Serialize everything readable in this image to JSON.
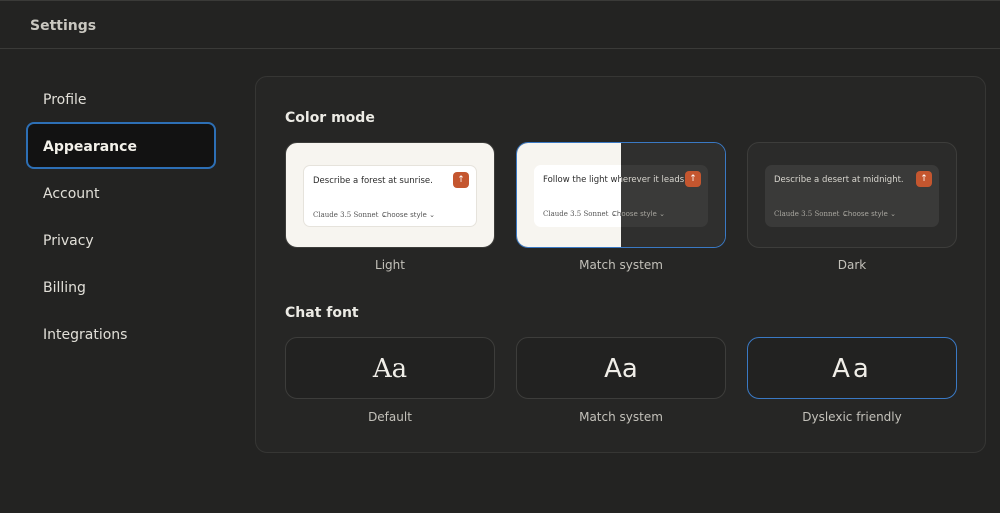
{
  "header": {
    "title": "Settings"
  },
  "sidebar": {
    "items": [
      {
        "label": "Profile"
      },
      {
        "label": "Appearance"
      },
      {
        "label": "Account"
      },
      {
        "label": "Privacy"
      },
      {
        "label": "Billing"
      },
      {
        "label": "Integrations"
      }
    ]
  },
  "color_mode": {
    "title": "Color mode",
    "selected": "Match system",
    "options": [
      {
        "label": "Light",
        "preview_prompt": "Describe a forest at sunrise.",
        "model": "Claude 3.5 Sonnet ⌄",
        "style": "Choose style ⌄"
      },
      {
        "label": "Match system",
        "preview_prompt": "Follow the light wherever it leads.",
        "model": "Claude 3.5 Sonnet ⌄",
        "style": "Choose style ⌄"
      },
      {
        "label": "Dark",
        "preview_prompt": "Describe a desert at midnight.",
        "model": "Claude 3.5 Sonnet ⌄",
        "style": "Choose style ⌄"
      }
    ],
    "send_icon": "arrow-up-icon",
    "accent_color": "#c4562f",
    "selection_color": "#3a79c4"
  },
  "chat_font": {
    "title": "Chat font",
    "selected": "Dyslexic friendly",
    "sample": "Aa",
    "options": [
      {
        "label": "Default"
      },
      {
        "label": "Match system"
      },
      {
        "label": "Dyslexic friendly"
      }
    ]
  }
}
